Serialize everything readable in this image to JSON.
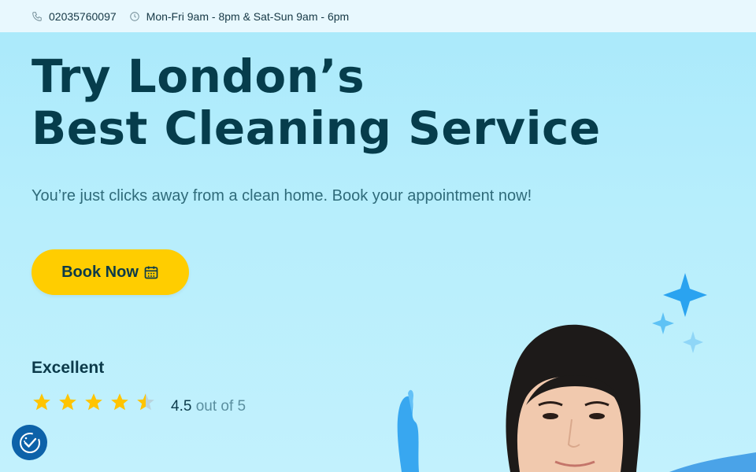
{
  "topbar": {
    "phone": "02035760097",
    "phone_icon": "phone-icon",
    "hours": "Mon-Fri 9am - 8pm & Sat-Sun 9am - 6pm",
    "hours_icon": "clock-icon"
  },
  "hero": {
    "title_line1": "Try London’s",
    "title_line2": "Best Cleaning Service",
    "subtitle": "You’re just clicks away from a clean home. Book your appointment now!",
    "cta_label": "Book Now",
    "cta_icon": "calendar-icon"
  },
  "rating": {
    "label": "Excellent",
    "stars_value": 4.5,
    "stars_max": 5,
    "score": "4.5",
    "suffix": "out of 5"
  },
  "cookie_button_icon": "cookie-consent-icon",
  "colors": {
    "accent": "#ffcd00",
    "title": "#063d4c",
    "background": "#a9e9fb",
    "cookie_button": "#0d62a9",
    "star": "#ffc400"
  }
}
